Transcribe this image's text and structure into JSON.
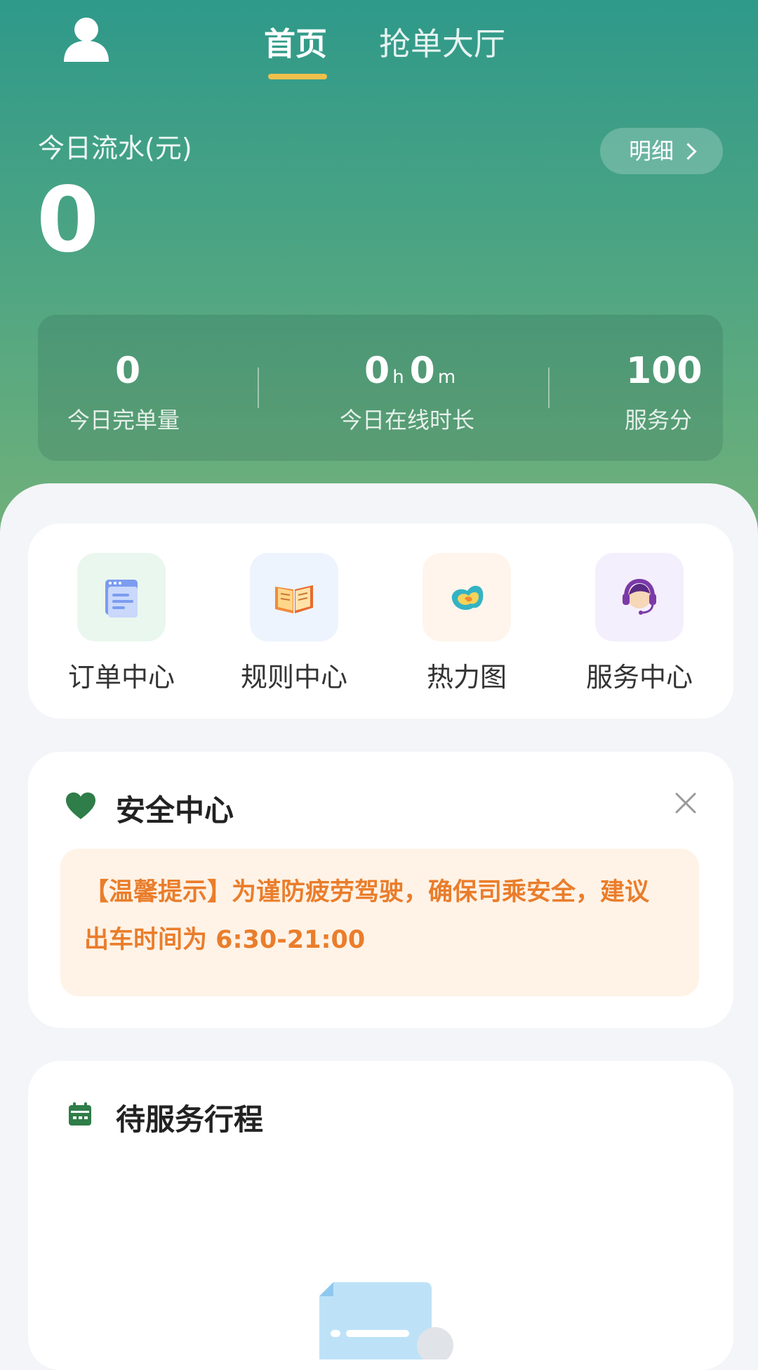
{
  "header": {
    "tabs": [
      {
        "label": "首页",
        "active": true
      },
      {
        "label": "抢单大厅",
        "active": false
      }
    ],
    "profile_icon": "user-icon",
    "accent_color": "#f0c04b"
  },
  "earnings": {
    "label": "今日流水(元)",
    "value": "0",
    "detail_button": "明细"
  },
  "stats": [
    {
      "value": "0",
      "label": "今日完单量"
    },
    {
      "hours": "0",
      "hours_unit": "h",
      "minutes": "0",
      "minutes_unit": "m",
      "label": "今日在线时长"
    },
    {
      "value": "100",
      "label": "服务分"
    }
  ],
  "quick_actions": [
    {
      "label": "订单中心",
      "icon": "document-icon"
    },
    {
      "label": "规则中心",
      "icon": "book-icon"
    },
    {
      "label": "热力图",
      "icon": "heatmap-icon"
    },
    {
      "label": "服务中心",
      "icon": "headset-icon"
    }
  ],
  "safety": {
    "title": "安全中心",
    "icon": "heart-icon",
    "notice_line1": "【温馨提示】为谨防疲劳驾驶，确保司乘安全，建议",
    "notice_line2": "出车时间为 6:30-21:00",
    "notice_color": "#ea7d2b"
  },
  "trips": {
    "title": "待服务行程",
    "icon": "calendar-icon"
  }
}
